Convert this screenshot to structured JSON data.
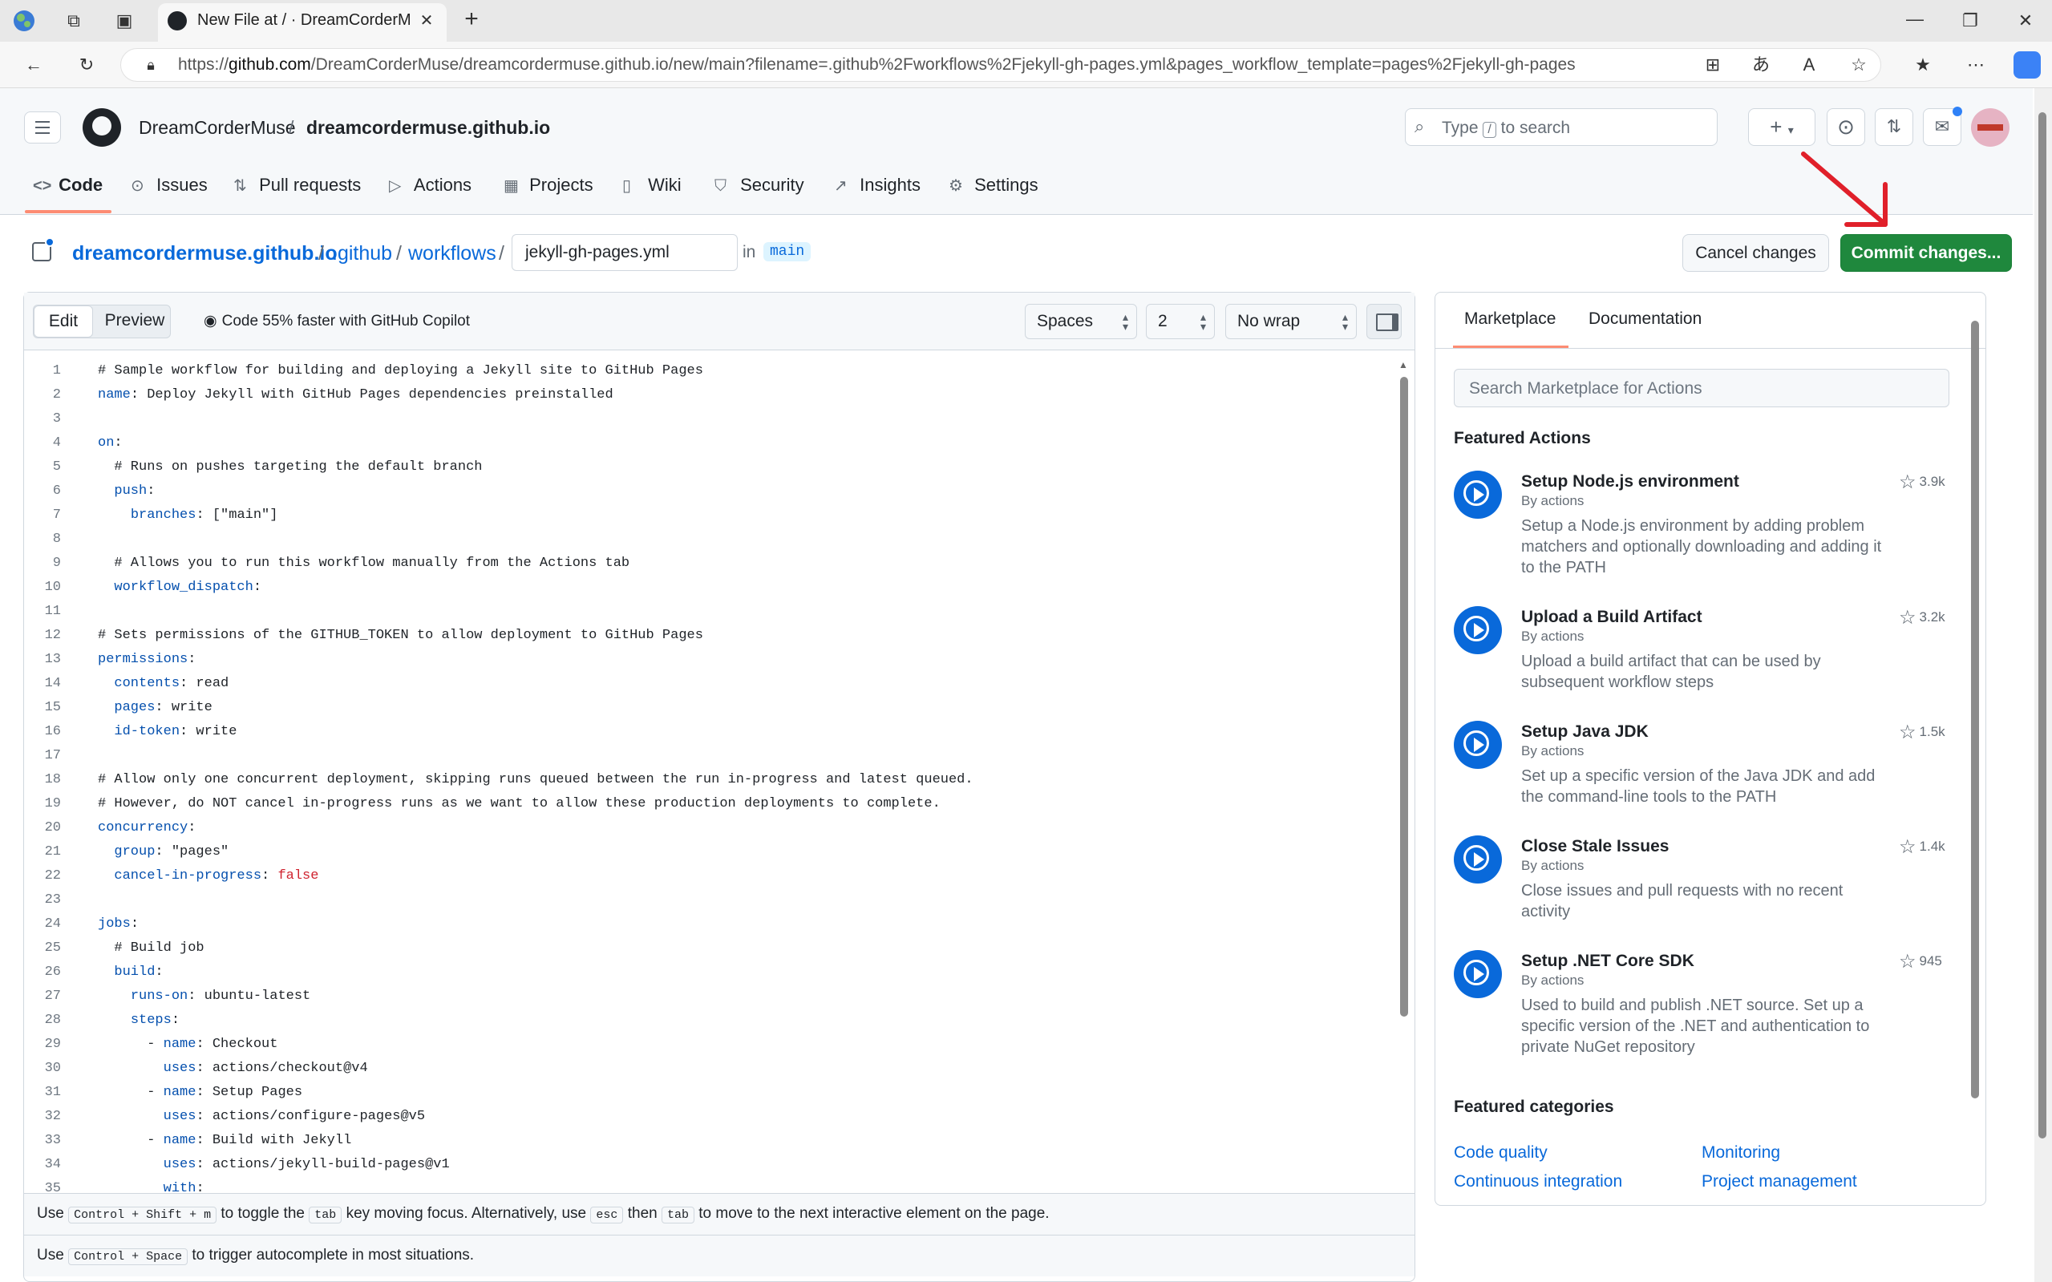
{
  "browser": {
    "tab_title": "New File at / · DreamCorderMuse",
    "url_prefix": "https://",
    "url_host": "github.com",
    "url_rest": "/DreamCorderMuse/dreamcordermuse.github.io/new/main?filename=.github%2Fworkflows%2Fjekyll-gh-pages.yml&pages_workflow_template=pages%2Fjekyll-gh-pages"
  },
  "header": {
    "owner": "DreamCorderMuse",
    "separator": "/",
    "repo": "dreamcordermuse.github.io",
    "search_placeholder_pre": "Type",
    "search_key": "/",
    "search_placeholder_post": "to search"
  },
  "nav": {
    "code": "Code",
    "issues": "Issues",
    "pulls": "Pull requests",
    "actions": "Actions",
    "projects": "Projects",
    "wiki": "Wiki",
    "security": "Security",
    "insights": "Insights",
    "settings": "Settings"
  },
  "breadcrumb": {
    "repo": "dreamcordermuse.github.io",
    "sep": "/",
    "dir1": ".github",
    "dir2": "workflows",
    "filename": "jekyll-gh-pages.yml",
    "in": "in",
    "branch": "main"
  },
  "actions": {
    "cancel": "Cancel changes",
    "commit": "Commit changes..."
  },
  "editor": {
    "edit_tab": "Edit",
    "preview_tab": "Preview",
    "copilot": "Code 55% faster with GitHub Copilot",
    "indent_mode": "Spaces",
    "indent_size": "2",
    "wrap_mode": "No wrap",
    "lines": [
      {
        "n": "1",
        "t": "# Sample workflow for building and deploying a Jekyll site to GitHub Pages"
      },
      {
        "n": "2",
        "k": "name",
        "t": ": Deploy Jekyll with GitHub Pages dependencies preinstalled"
      },
      {
        "n": "3",
        "t": ""
      },
      {
        "n": "4",
        "k": "on",
        "t": ":"
      },
      {
        "n": "5",
        "t": "  # Runs on pushes targeting the default branch"
      },
      {
        "n": "6",
        "ind": "  ",
        "k": "push",
        "t": ":"
      },
      {
        "n": "7",
        "ind": "    ",
        "k": "branches",
        "t": ": [\"main\"]"
      },
      {
        "n": "8",
        "t": ""
      },
      {
        "n": "9",
        "t": "  # Allows you to run this workflow manually from the Actions tab"
      },
      {
        "n": "10",
        "ind": "  ",
        "k": "workflow_dispatch",
        "t": ":"
      },
      {
        "n": "11",
        "t": ""
      },
      {
        "n": "12",
        "t": "# Sets permissions of the GITHUB_TOKEN to allow deployment to GitHub Pages"
      },
      {
        "n": "13",
        "k": "permissions",
        "t": ":"
      },
      {
        "n": "14",
        "ind": "  ",
        "k": "contents",
        "t": ": read"
      },
      {
        "n": "15",
        "ind": "  ",
        "k": "pages",
        "t": ": write"
      },
      {
        "n": "16",
        "ind": "  ",
        "k": "id-token",
        "t": ": write"
      },
      {
        "n": "17",
        "t": ""
      },
      {
        "n": "18",
        "t": "# Allow only one concurrent deployment, skipping runs queued between the run in-progress and latest queued."
      },
      {
        "n": "19",
        "t": "# However, do NOT cancel in-progress runs as we want to allow these production deployments to complete."
      },
      {
        "n": "20",
        "k": "concurrency",
        "t": ":"
      },
      {
        "n": "21",
        "ind": "  ",
        "k": "group",
        "t": ": \"pages\""
      },
      {
        "n": "22",
        "ind": "  ",
        "k": "cancel-in-progress",
        "t": ": ",
        "f": "false"
      },
      {
        "n": "23",
        "t": ""
      },
      {
        "n": "24",
        "k": "jobs",
        "t": ":"
      },
      {
        "n": "25",
        "t": "  # Build job"
      },
      {
        "n": "26",
        "ind": "  ",
        "k": "build",
        "t": ":"
      },
      {
        "n": "27",
        "ind": "    ",
        "k": "runs-on",
        "t": ": ubuntu-latest"
      },
      {
        "n": "28",
        "ind": "    ",
        "k": "steps",
        "t": ":"
      },
      {
        "n": "29",
        "ind": "      - ",
        "k": "name",
        "t": ": Checkout"
      },
      {
        "n": "30",
        "ind": "        ",
        "k": "uses",
        "t": ": actions/checkout@v4"
      },
      {
        "n": "31",
        "ind": "      - ",
        "k": "name",
        "t": ": Setup Pages"
      },
      {
        "n": "32",
        "ind": "        ",
        "k": "uses",
        "t": ": actions/configure-pages@v5"
      },
      {
        "n": "33",
        "ind": "      - ",
        "k": "name",
        "t": ": Build with Jekyll"
      },
      {
        "n": "34",
        "ind": "        ",
        "k": "uses",
        "t": ": actions/jekyll-build-pages@v1"
      },
      {
        "n": "35",
        "ind": "        ",
        "k": "with",
        "t": ":"
      }
    ],
    "hint1": {
      "use": "Use",
      "k1": "Control + Shift + m",
      "mid1": "to toggle the",
      "k2": "tab",
      "mid2": "key moving focus. Alternatively, use",
      "k3": "esc",
      "mid3": "then",
      "k4": "tab",
      "end": "to move to the next interactive element on the page."
    },
    "hint2": {
      "use": "Use",
      "k1": "Control + Space",
      "end": "to trigger autocomplete in most situations."
    }
  },
  "marketplace": {
    "tab_marketplace": "Marketplace",
    "tab_docs": "Documentation",
    "search_placeholder": "Search Marketplace for Actions",
    "featured_title": "Featured Actions",
    "items": [
      {
        "title": "Setup Node.js environment",
        "by": "By actions",
        "stars": "3.9k",
        "desc": "Setup a Node.js environment by adding problem matchers and optionally downloading and adding it to the PATH"
      },
      {
        "title": "Upload a Build Artifact",
        "by": "By actions",
        "stars": "3.2k",
        "desc": "Upload a build artifact that can be used by subsequent workflow steps"
      },
      {
        "title": "Setup Java JDK",
        "by": "By actions",
        "stars": "1.5k",
        "desc": "Set up a specific version of the Java JDK and add the command-line tools to the PATH"
      },
      {
        "title": "Close Stale Issues",
        "by": "By actions",
        "stars": "1.4k",
        "desc": "Close issues and pull requests with no recent activity"
      },
      {
        "title": "Setup .NET Core SDK",
        "by": "By actions",
        "stars": "945",
        "desc": "Used to build and publish .NET source. Set up a specific version of the .NET and authentication to private NuGet repository"
      }
    ],
    "categories_title": "Featured categories",
    "categories": [
      "Code quality",
      "Monitoring",
      "Continuous integration",
      "Project management"
    ]
  },
  "colors": {
    "accent": "#0969da",
    "commit_button": "#1f883d",
    "nav_underline": "#fd8c73",
    "annotation_arrow": "#e0202a"
  }
}
